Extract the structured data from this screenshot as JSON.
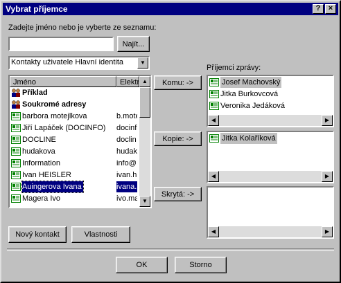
{
  "window": {
    "title": "Vybrat příjemce",
    "help_label": "?",
    "close_label": "×"
  },
  "search": {
    "prompt": "Zadejte jméno nebo je vyberte ze seznamu:",
    "value": "",
    "find_label": "Najít..."
  },
  "source": {
    "selected": "Kontakty uživatele Hlavní identita"
  },
  "contacts": {
    "columns": [
      "Jméno",
      "Elektro"
    ],
    "items": [
      {
        "name": "Příklad",
        "email": "",
        "icon": "group-icon",
        "bold": true,
        "selected": false
      },
      {
        "name": "Soukromé adresy",
        "email": "",
        "icon": "group-icon",
        "bold": true,
        "selected": false
      },
      {
        "name": "barbora motejlkova",
        "email": "b.mote",
        "icon": "contact-card-icon",
        "bold": false,
        "selected": false
      },
      {
        "name": "Jiří Lapáček (DOCINFO)",
        "email": "docinf",
        "icon": "contact-card-icon",
        "bold": false,
        "selected": false
      },
      {
        "name": "DOCLINE",
        "email": "doclin",
        "icon": "contact-card-icon",
        "bold": false,
        "selected": false
      },
      {
        "name": "hudakova",
        "email": "hudak",
        "icon": "contact-card-icon",
        "bold": false,
        "selected": false
      },
      {
        "name": "Information",
        "email": "info@",
        "icon": "contact-card-icon",
        "bold": false,
        "selected": false
      },
      {
        "name": "Ivan HEISLER",
        "email": "ivan.h",
        "icon": "contact-card-icon",
        "bold": false,
        "selected": false
      },
      {
        "name": "Auingerova Ivana",
        "email": "ivana.",
        "icon": "contact-card-icon",
        "bold": false,
        "selected": true
      },
      {
        "name": "Magera Ivo",
        "email": "ivo.ma",
        "icon": "contact-card-icon",
        "bold": false,
        "selected": false
      }
    ]
  },
  "left_buttons": {
    "new_contact": "Nový kontakt",
    "properties": "Vlastnosti"
  },
  "recipients": {
    "label": "Příjemci zprávy:",
    "to_button": "Komu: ->",
    "cc_button": "Kopie: ->",
    "bcc_button": "Skrytá: ->",
    "to": [
      "Josef Machovský",
      "Jitka Burkovcová",
      "Veronika Jedáková"
    ],
    "cc": [
      "Jitka Kolaříková"
    ],
    "bcc": []
  },
  "footer": {
    "ok": "OK",
    "cancel": "Storno"
  },
  "colors": {
    "title_bar": "#000080",
    "selection": "#000080",
    "face": "#c0c0c0"
  }
}
